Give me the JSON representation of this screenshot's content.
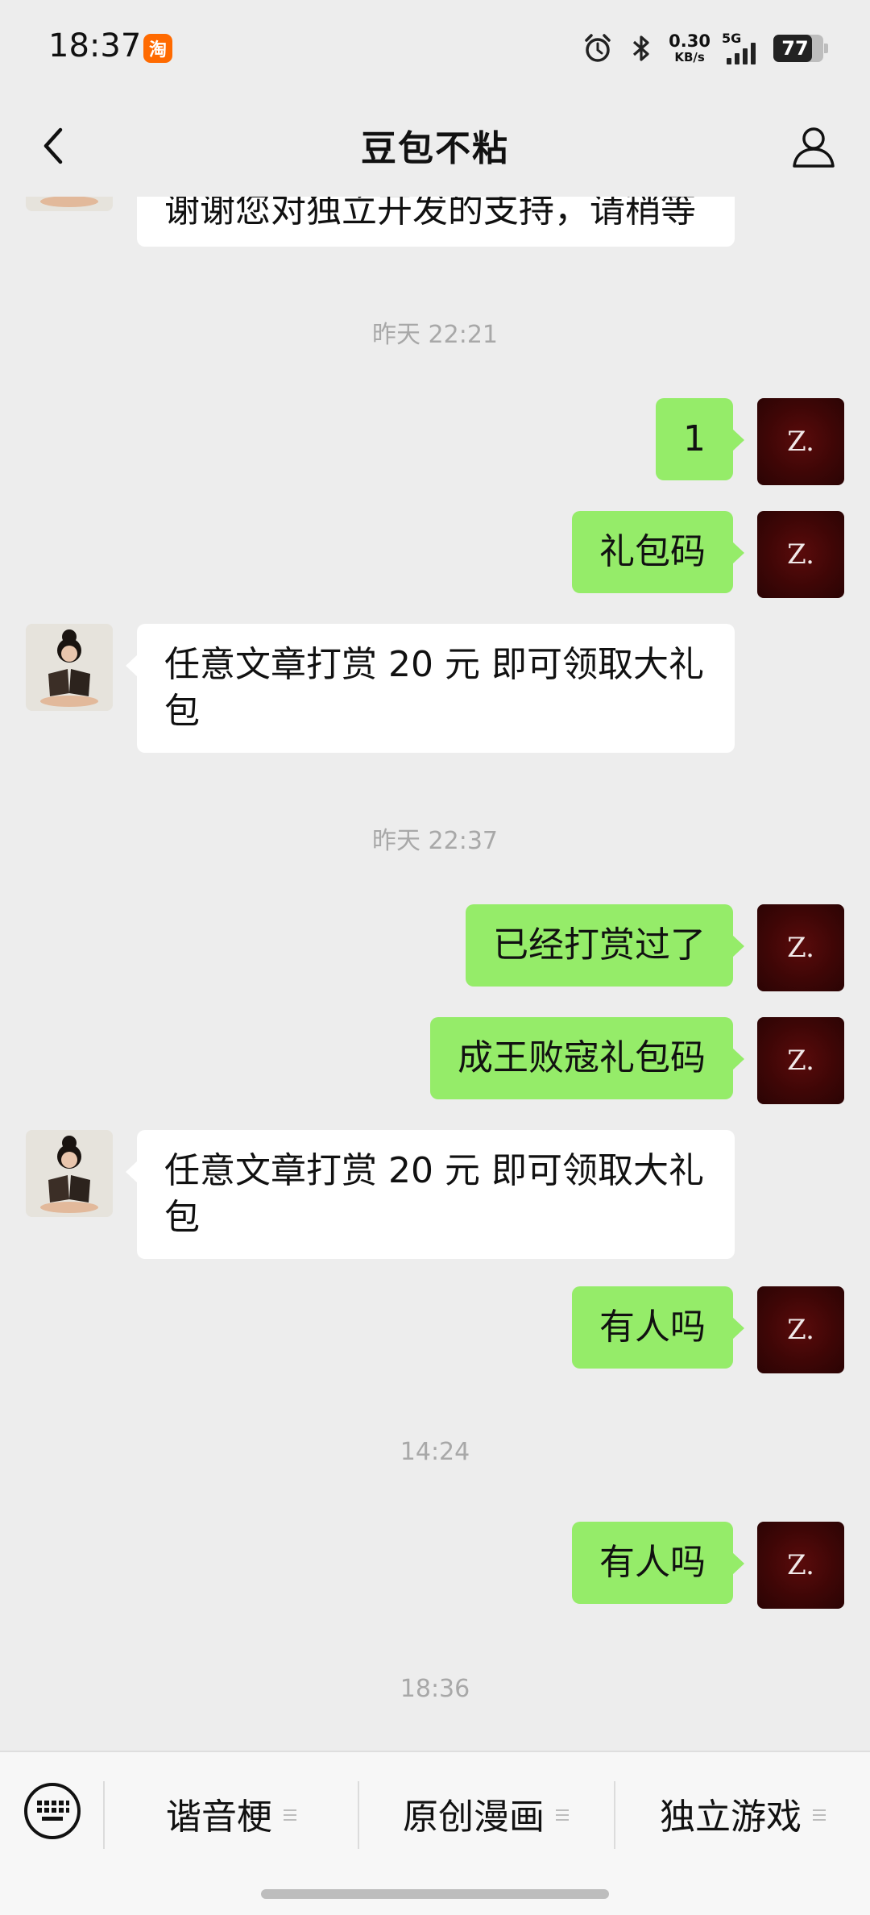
{
  "status_bar": {
    "time": "18:37",
    "taobao_badge": "淘",
    "net_speed_value": "0.30",
    "net_speed_unit": "KB/s",
    "network_type": "5G",
    "battery_level": "77",
    "icons": [
      "alarm-icon",
      "bluetooth-icon",
      "signal-icon",
      "battery-icon"
    ]
  },
  "nav": {
    "title": "豆包不粘",
    "back_icon": "chevron-left-icon",
    "profile_icon": "person-icon"
  },
  "chat": {
    "partial_top_message": "谢谢您对独立开发的支持，请稍等",
    "timestamps": [
      "昨天 22:21",
      "昨天 22:37",
      "14:24",
      "18:36"
    ],
    "messages": [
      {
        "from": "me",
        "text": "1"
      },
      {
        "from": "me",
        "text": "礼包码"
      },
      {
        "from": "them",
        "text": "任意文章打赏 20 元 即可领取大礼包"
      },
      {
        "from": "me",
        "text": "已经打赏过了"
      },
      {
        "from": "me",
        "text": "成王败寇礼包码"
      },
      {
        "from": "them",
        "text": "任意文章打赏 20 元 即可领取大礼包"
      },
      {
        "from": "me",
        "text": "有人吗"
      },
      {
        "from": "me",
        "text": "有人吗"
      }
    ],
    "my_avatar_mark": "Z."
  },
  "bottom_menu": {
    "keyboard_icon": "keyboard-icon",
    "items": [
      {
        "label": "谐音梗"
      },
      {
        "label": "原创漫画"
      },
      {
        "label": "独立游戏"
      }
    ]
  },
  "colors": {
    "background": "#ededed",
    "bubble_outgoing": "#95ec69",
    "bubble_incoming": "#ffffff",
    "timestamp_text": "#a8a8a8",
    "taobao_badge": "#ff6a00",
    "my_avatar": "#4a0808"
  }
}
